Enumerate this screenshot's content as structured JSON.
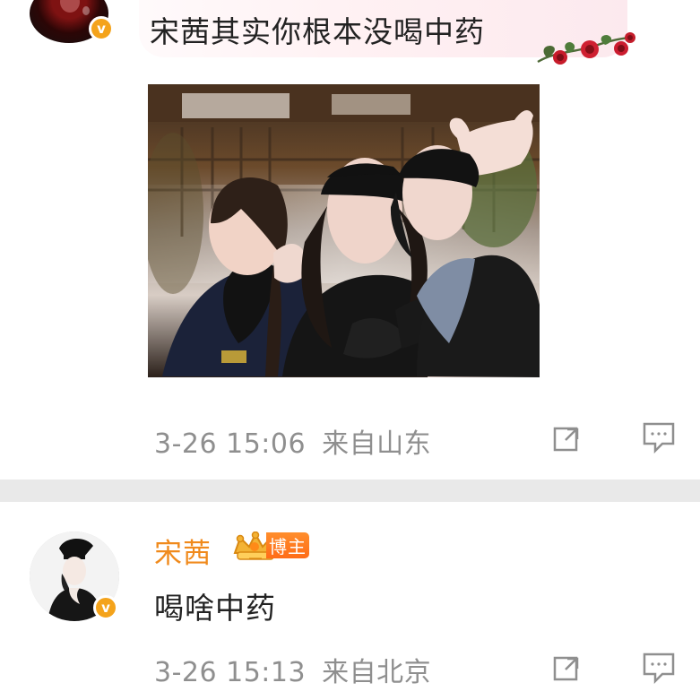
{
  "comments": [
    {
      "text": "宋茜其实你根本没喝中药",
      "time": "3-26 15:06",
      "location": "来自山东",
      "verified_mark": "v",
      "icons": {
        "share": "share-icon",
        "reply": "comment-icon"
      },
      "colors": {
        "meta": "#8f8f8f",
        "bubble_start": "#fffafb",
        "bubble_end": "#fce9ee",
        "verified": "#f4a31b"
      }
    },
    {
      "username": "宋茜",
      "badge": "博主",
      "text": "喝啥中药",
      "time": "3-26 15:13",
      "location": "来自北京",
      "verified_mark": "v",
      "icons": {
        "share": "share-icon",
        "reply": "comment-icon"
      },
      "colors": {
        "username": "#f08a1c",
        "badge": "#ff6c18",
        "meta": "#8f8f8f",
        "verified": "#f4a31b"
      }
    }
  ]
}
